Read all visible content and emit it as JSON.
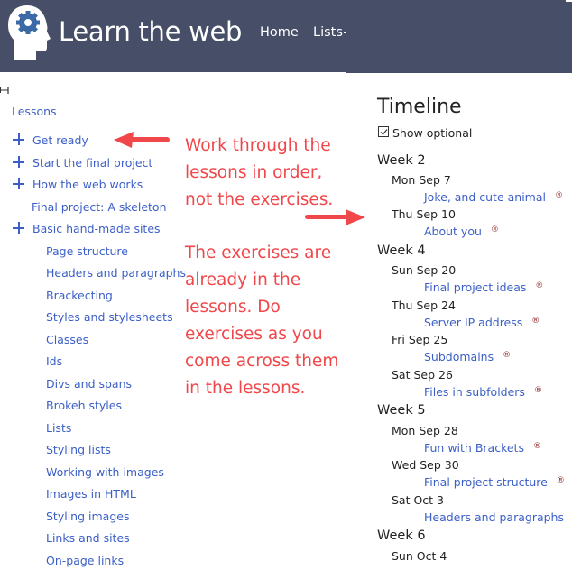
{
  "header": {
    "site_title": "Learn the web",
    "nav": [
      {
        "label": "Home"
      },
      {
        "label": "Lists"
      }
    ],
    "background_color": "#474f68"
  },
  "sidebar": {
    "title": "Lessons",
    "items": [
      {
        "label": "Get ready",
        "expandable": true,
        "level": 0
      },
      {
        "label": "Start the final project",
        "expandable": true,
        "level": 0
      },
      {
        "label": "How the web works",
        "expandable": true,
        "level": 0
      },
      {
        "label": "Final project: A skeleton",
        "expandable": false,
        "level": 0
      },
      {
        "label": "Basic hand-made sites",
        "expandable": true,
        "level": 0
      },
      {
        "label": "Page structure",
        "level": 1
      },
      {
        "label": "Headers and paragraphs",
        "level": 1
      },
      {
        "label": "Brackecting",
        "level": 1
      },
      {
        "label": "Styles and stylesheets",
        "level": 1
      },
      {
        "label": "Classes",
        "level": 1
      },
      {
        "label": "Ids",
        "level": 1
      },
      {
        "label": "Divs and spans",
        "level": 1
      },
      {
        "label": "Brokeh styles",
        "level": 1
      },
      {
        "label": "Lists",
        "level": 1
      },
      {
        "label": "Styling lists",
        "level": 1
      },
      {
        "label": "Working with images",
        "level": 1
      },
      {
        "label": "Images in HTML",
        "level": 1
      },
      {
        "label": "Styling images",
        "level": 1
      },
      {
        "label": "Links and sites",
        "level": 1
      },
      {
        "label": "On-page links",
        "level": 1
      }
    ],
    "link_color": "#3b5fc7"
  },
  "annotations": {
    "color": "#f0474a",
    "note1": [
      "Work through the",
      "lessons in order,",
      "not the exercises."
    ],
    "note2": [
      "The exercises are",
      "already in the",
      "lessons. Do",
      "exercises as you",
      "come across them",
      "in the lessons."
    ]
  },
  "timeline": {
    "title": "Timeline",
    "show_optional_label": "Show optional",
    "show_optional_checked": true,
    "required_mark": "®",
    "weeks": [
      {
        "label": "Week 2",
        "days": [
          {
            "label": "Mon Sep 7",
            "tasks": [
              "Joke, and cute animal"
            ]
          },
          {
            "label": "Thu Sep 10",
            "tasks": [
              "About you"
            ]
          }
        ]
      },
      {
        "label": "Week 4",
        "days": [
          {
            "label": "Sun Sep 20",
            "tasks": [
              "Final project ideas"
            ]
          },
          {
            "label": "Thu Sep 24",
            "tasks": [
              "Server IP address"
            ]
          },
          {
            "label": "Fri Sep 25",
            "tasks": [
              "Subdomains"
            ]
          },
          {
            "label": "Sat Sep 26",
            "tasks": [
              "Files in subfolders"
            ]
          }
        ]
      },
      {
        "label": "Week 5",
        "days": [
          {
            "label": "Mon Sep 28",
            "tasks": [
              "Fun with Brackets"
            ]
          },
          {
            "label": "Wed Sep 30",
            "tasks": [
              "Final project structure"
            ]
          },
          {
            "label": "Sat Oct 3",
            "tasks": [
              "Headers and paragraphs"
            ]
          }
        ]
      },
      {
        "label": "Week 6",
        "days": [
          {
            "label": "Sun Oct 4",
            "tasks": []
          }
        ]
      }
    ]
  }
}
